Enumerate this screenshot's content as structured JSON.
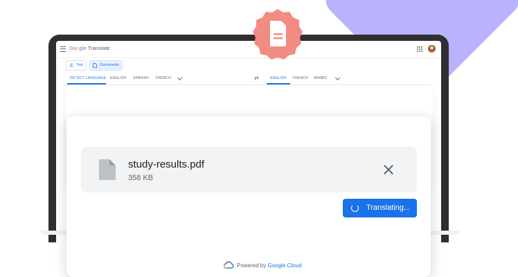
{
  "app": {
    "logo_google": "Google",
    "logo_product": "Translate"
  },
  "mode_tabs": [
    {
      "label": "Text",
      "icon": "translate-icon",
      "active": false
    },
    {
      "label": "Documents",
      "icon": "document-icon",
      "active": true
    }
  ],
  "source_languages": [
    "DETECT LANGUAGE",
    "ENGLISH",
    "SPANISH",
    "FRENCH"
  ],
  "target_languages": [
    "ENGLISH",
    "FRENCH",
    "ARABIC"
  ],
  "upload": {
    "file_name": "study-results.pdf",
    "file_size": "358 KB",
    "button_label": "Translating..."
  },
  "footer": {
    "powered_prefix": "Powered by",
    "powered_link": "Google Cloud"
  },
  "colors": {
    "accent": "#1a73e8",
    "badge": "#f28b82",
    "background_shape": "#b9b3fb"
  }
}
